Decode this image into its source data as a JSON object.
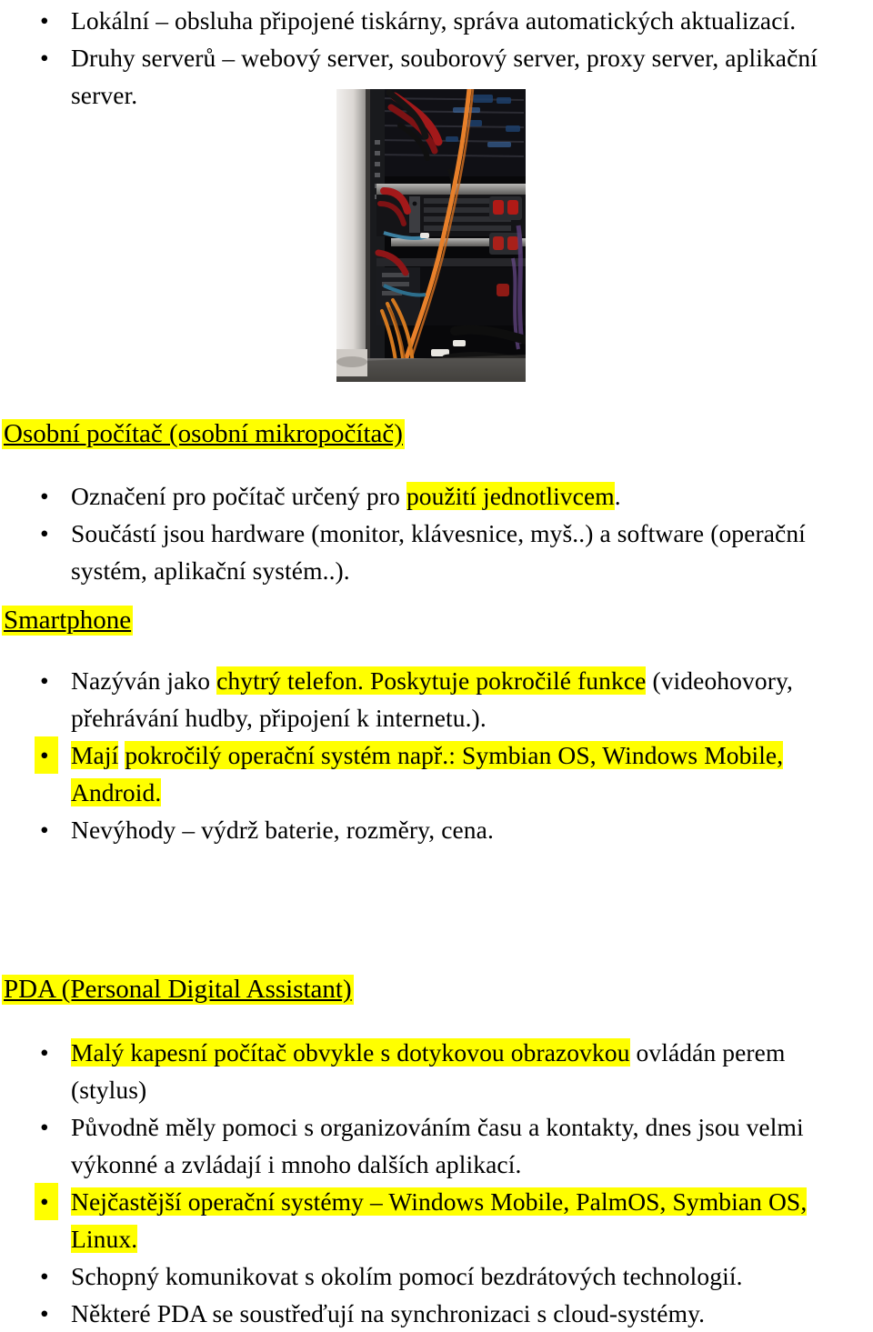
{
  "document": {
    "language": "cs",
    "title": "Osobní počítač, Smartphone, PDA",
    "highlight_color": "#FFFF00",
    "text_color": "#000000",
    "background_color": "#FFFFFF"
  },
  "top_bullets": {
    "items": [
      {
        "line1": "Lokální – obsluha připojené tiskárny, správa automatických aktualizací.",
        "line2": ""
      },
      {
        "line1": "Druhy serverů – webový server, souborový server, proxy server, aplikační",
        "line2": "server."
      }
    ]
  },
  "photo": {
    "name": "server-rack-photo",
    "caption": "",
    "description": "Fotografie serverového racku s kabeláží"
  },
  "pc_section": {
    "heading": "Osobní počítač (osobní mikropočítač)",
    "bullets": [
      {
        "parts": [
          {
            "text": "Označení pro počítač určený pro ",
            "highlight": false
          },
          {
            "text": "použití jednotlivcem",
            "highlight": true
          },
          {
            "text": ".",
            "highlight": false
          }
        ]
      },
      {
        "parts": [
          {
            "text": "Součástí jsou hardware (monitor, klávesnice, myš..) a software (operační",
            "highlight": false
          }
        ],
        "continuation": "systém, aplikační systém..)."
      }
    ]
  },
  "smartphone_section": {
    "heading": "Smartphone",
    "bullets": [
      {
        "bullet_highlighted": false,
        "parts": [
          {
            "text": "Nazýván jako ",
            "highlight": false
          },
          {
            "text": "chytrý telefon. Poskytuje pokročilé funkce",
            "highlight": true
          },
          {
            "text": " (videohovory,",
            "highlight": false
          }
        ],
        "continuation": "přehrávání hudby, připojení k internetu.)."
      },
      {
        "bullet_highlighted": true,
        "parts": [
          {
            "text": "Mají",
            "highlight": true
          },
          {
            "text": " ",
            "highlight": false
          },
          {
            "text": "pokročilý operační systém např.: Symbian OS, Windows Mobile,",
            "highlight": true
          }
        ],
        "continuation": "Android.",
        "continuation_highlighted": true
      },
      {
        "bullet_highlighted": false,
        "parts": [
          {
            "text": "Nevýhody – výdrž baterie, rozměry, cena.",
            "highlight": false
          }
        ]
      }
    ]
  },
  "pda_section": {
    "heading": "PDA (Personal Digital Assistant)",
    "bullets": [
      {
        "bullet_highlighted": false,
        "parts": [
          {
            "text": "Malý kapesní počítač obvykle s dotykovou obrazovkou",
            "highlight": true
          },
          {
            "text": " ovládán perem",
            "highlight": false
          }
        ],
        "continuation": "(stylus)",
        "continuation_highlighted": false
      },
      {
        "bullet_highlighted": false,
        "parts": [
          {
            "text": "Původně měly pomoci s organizováním času a kontakty, dnes jsou velmi",
            "highlight": false
          }
        ],
        "continuation": "výkonné a zvládají i mnoho dalších aplikací.",
        "continuation_highlighted": false
      },
      {
        "bullet_highlighted": true,
        "parts": [
          {
            "text": "Nejčastější operační systémy – Windows Mobile, PalmOS, Symbian OS,",
            "highlight": true
          }
        ],
        "continuation": "Linux.",
        "continuation_highlighted": true
      },
      {
        "bullet_highlighted": false,
        "parts": [
          {
            "text": "Schopný komunikovat s okolím pomocí bezdrátových technologií.",
            "highlight": false
          }
        ]
      },
      {
        "bullet_highlighted": false,
        "parts": [
          {
            "text": "Některé PDA se soustřeďují na synchronizaci s cloud-systémy.",
            "highlight": false
          }
        ]
      }
    ]
  },
  "glyphs": {
    "bullet": "•"
  }
}
